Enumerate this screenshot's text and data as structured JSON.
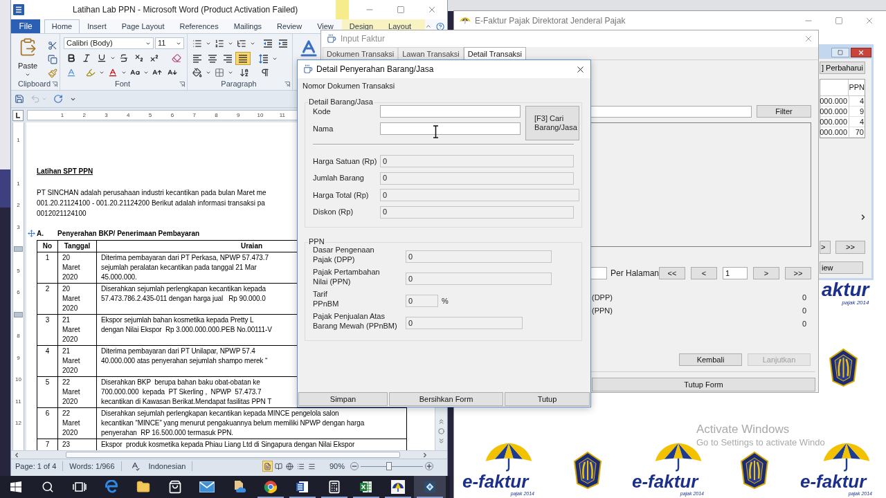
{
  "word": {
    "title": "Latihan Lab PPN - Microsoft Word (Product Activation Failed)",
    "tabs": [
      {
        "label": "File",
        "kind": "file",
        "selected": false
      },
      {
        "label": "Home",
        "kind": "main",
        "selected": true
      },
      {
        "label": "Insert",
        "kind": "main",
        "selected": false
      },
      {
        "label": "Page Layout",
        "kind": "main",
        "selected": false
      },
      {
        "label": "References",
        "kind": "main",
        "selected": false
      },
      {
        "label": "Mailings",
        "kind": "main",
        "selected": false
      },
      {
        "label": "Review",
        "kind": "main",
        "selected": false
      },
      {
        "label": "View",
        "kind": "main",
        "selected": false
      },
      {
        "label": "Design",
        "kind": "contextual",
        "selected": false
      },
      {
        "label": "Layout",
        "kind": "contextual",
        "selected": false
      }
    ],
    "clipboard": {
      "label": "Clipboard",
      "paste": "Paste"
    },
    "font": {
      "label": "Font",
      "name": "Calibri (Body)",
      "size": "11"
    },
    "paragraph": {
      "label": "Paragraph",
      "alignment": [
        {
          "kind": "left",
          "selected": false
        },
        {
          "kind": "center",
          "selected": false
        },
        {
          "kind": "right",
          "selected": false
        },
        {
          "kind": "justify",
          "selected": true
        }
      ]
    },
    "quick_access": [
      {
        "kind": "save",
        "disabled": false
      },
      {
        "kind": "undo",
        "disabled": true
      },
      {
        "kind": "repeat",
        "disabled": false
      }
    ],
    "ruler": [
      "1",
      "2",
      "3",
      "4",
      "5",
      "6",
      "7",
      "8",
      "9",
      "10",
      "11"
    ],
    "vertical_ruler": [
      "1",
      "1",
      "2",
      "3",
      "5",
      "6",
      "8",
      "9",
      "10",
      "11",
      "12"
    ],
    "document": {
      "title": "Latihan SPT PPN",
      "paragraph": [
        "PT SINCHAN adalah perusahaan industri kecantikan pada bulan Maret me",
        "001.20.21124100 - 001.20.21124200 Berikut adalah informasi transaksi pa",
        "0012021124100"
      ],
      "section": {
        "letter": "A.",
        "title": "Penyerahan BKP/ Penerimaan Pembayaran"
      },
      "table": {
        "columns": [
          "No",
          "Tanggal",
          "Uraian"
        ],
        "rows": [
          {
            "no": "1",
            "date": [
              "20",
              "Maret",
              "2020"
            ],
            "description": [
              "Diterima pembayaran dari PT Perkasa, NPWP 57.473.7",
              "sejumlah peralatan kecantikan pada tanggal 21 Mar",
              "45.000.000."
            ]
          },
          {
            "no": "2",
            "date": [
              "20",
              "Maret",
              "2020"
            ],
            "description": [
              "Diserahkan sejumlah perlengkapan kecantikan kepada",
              "57.473.786.2.435-011 dengan harga jual   Rp 90.000.0"
            ]
          },
          {
            "no": "3",
            "date": [
              "21",
              "Maret",
              "2020"
            ],
            "description": [
              "Ekspor sejumlah bahan kosmetika kepada Pretty L",
              "dengan Nilai Ekspor  Rp 3.000.000.000.PEB No.00111-V"
            ]
          },
          {
            "no": "4",
            "date": [
              "21",
              "Maret",
              "2020"
            ],
            "description": [
              "Diterima pembayaran dari PT Unilapar, NPWP 57.4",
              "40.000.000 atas penyerahan sejumlah shampo merek “"
            ]
          },
          {
            "no": "5",
            "date": [
              "22",
              "Maret",
              "2020"
            ],
            "description": [
              "Diserahkan BKP  berupa bahan baku obat-obatan ke",
              "700.000.000  kepada  PT Skerling ,  NPWP  57.473.7",
              "kecantikan di Kawasan Berikat.Mendapat fasilitas PPN T"
            ]
          },
          {
            "no": "6",
            "date": [
              "22",
              "Maret",
              "2020"
            ],
            "description": [
              "Diserahkan sejumlah perlengkapan kecantikan kepada MINCE pengelola salon",
              "kecantikan “MINCE” yang menurut pengakuannya belum memiliki NPWP dengan harga",
              "penyerahan  RP 16.500.000 termasuk PPN."
            ]
          },
          {
            "no": "7",
            "date": [
              "23"
            ],
            "description": [
              "Ekspor  produk kosmetika kepada Phiau Liang Ltd di Singapura dengan Nilai Ekspor"
            ]
          }
        ]
      }
    },
    "status_bar": {
      "page": "Page: 1 of 4",
      "words": "Words: 1/966",
      "language": "Indonesian",
      "views": [
        {
          "kind": "print_layout",
          "selected": true
        },
        {
          "kind": "full_screen",
          "selected": false
        },
        {
          "kind": "web",
          "selected": false
        },
        {
          "kind": "outline",
          "selected": false
        },
        {
          "kind": "draft",
          "selected": false
        }
      ],
      "zoom": "90%",
      "zoom_slider": {
        "level": 0.45
      }
    }
  },
  "efaktur": {
    "title": "E-Faktur Pajak Direktorat Jenderal Pajak",
    "active": false,
    "partial_logo": {
      "text": "aktur",
      "subtitle": "pajak 2014"
    },
    "logos": [
      {
        "text": "e-faktur",
        "subtitle": "pajak 2014"
      },
      {
        "text": "e-faktur",
        "subtitle": "pajak 2014"
      },
      {
        "text": "e-faktur",
        "subtitle": "pajak 2014"
      }
    ]
  },
  "child_window": {
    "refresh_button": "] Perbaharui",
    "table": {
      "column": "PPN",
      "rows": [
        {
          "amount": "000.000",
          "ppn": "4"
        },
        {
          "amount": "000.000",
          "ppn": "9"
        },
        {
          "amount": "000.000",
          "ppn": "4"
        },
        {
          "amount": "000.000",
          "ppn": "70"
        }
      ]
    },
    "nav_buttons": [
      ">",
      ">>"
    ],
    "view_button": "iew"
  },
  "input_faktur": {
    "title": "Input Faktur",
    "active": false,
    "tabs": [
      {
        "label": "Dokumen Transaksi",
        "selected": false
      },
      {
        "label": "Lawan Transaksi",
        "selected": false
      },
      {
        "label": "Detail Transaksi",
        "selected": true
      }
    ],
    "filter": "Filter",
    "per_page": "Per Halaman",
    "pager": [
      {
        "label": "<<",
        "kind": "button"
      },
      {
        "label": "<",
        "kind": "button"
      },
      {
        "label": "1",
        "kind": "field"
      },
      {
        "label": ">",
        "kind": "button"
      },
      {
        "label": ">>",
        "kind": "button"
      }
    ],
    "totals": [
      {
        "label": "(DPP)",
        "value": "0"
      },
      {
        "label": "(PPN)",
        "value": "0"
      },
      {
        "value": "0"
      }
    ],
    "actions": [
      {
        "label": "Kembali",
        "disabled": false
      },
      {
        "label": "Lanjutkan",
        "disabled": true
      }
    ],
    "close_form": "Tutup Form"
  },
  "detail_dialog": {
    "title": "Detail Penyerahan Barang/Jasa",
    "active": true,
    "document_number_label": "Nomor Dokumen Transaksi",
    "item_group": {
      "title": "Detail Barang/Jasa",
      "lookup_fields": [
        {
          "label": "Kode",
          "disabled": false
        },
        {
          "label": "Nama",
          "disabled": false
        }
      ],
      "search_button": [
        "[F3] Cari",
        "Barang/Jasa"
      ],
      "amounts": [
        {
          "label": "Harga Satuan (Rp)",
          "value": "0",
          "disabled": true,
          "kind": "normal"
        },
        {
          "label": "Jumlah Barang",
          "value": "0",
          "disabled": true,
          "kind": "normal"
        },
        {
          "label": "Harga Total (Rp)",
          "value": "0",
          "disabled": true,
          "kind": "wide"
        },
        {
          "label": "Diskon (Rp)",
          "value": "0",
          "disabled": true,
          "kind": "normal"
        }
      ]
    },
    "tax_group": {
      "title": "PPN",
      "fields": [
        {
          "label": [
            "Dasar Pengenaan",
            "Pajak (DPP)"
          ],
          "value": "0",
          "kind": "wide",
          "disabled": true
        },
        {
          "label": [
            "Pajak Pertambahan",
            "Nilai (PPN)"
          ],
          "value": "0",
          "kind": "wide",
          "disabled": true
        },
        {
          "label": [
            "Tarif",
            "PPnBM"
          ],
          "value": "0",
          "kind": "rate",
          "unit": "%",
          "disabled": true
        },
        {
          "label": [
            "Pajak Penjualan Atas",
            "Barang Mewah (PPnBM)"
          ],
          "value": "0",
          "kind": "medium",
          "disabled": true
        }
      ]
    },
    "buttons": [
      "Simpan",
      "Bersihkan Form",
      "Tutup"
    ]
  },
  "taskbar": [
    {
      "kind": "start",
      "running": false,
      "selected": false
    },
    {
      "kind": "search",
      "running": false,
      "selected": false
    },
    {
      "kind": "task_view",
      "running": false,
      "selected": false
    },
    {
      "kind": "edge",
      "running": false,
      "selected": false
    },
    {
      "kind": "explorer",
      "running": false,
      "selected": false
    },
    {
      "kind": "store",
      "running": false,
      "selected": false
    },
    {
      "kind": "mail",
      "running": false,
      "selected": false
    },
    {
      "kind": "files",
      "running": false,
      "selected": false
    },
    {
      "kind": "chrome",
      "running": true,
      "selected": false
    },
    {
      "kind": "word",
      "running": true,
      "selected": false
    },
    {
      "kind": "calculator",
      "running": true,
      "selected": false
    },
    {
      "kind": "excel",
      "running": true,
      "selected": false
    },
    {
      "kind": "efaktur",
      "running": true,
      "selected": false
    },
    {
      "kind": "app",
      "running": true,
      "selected": true
    }
  ],
  "activation": {
    "title": "Activate Windows",
    "hint": "Go to Settings to activate Windo"
  }
}
